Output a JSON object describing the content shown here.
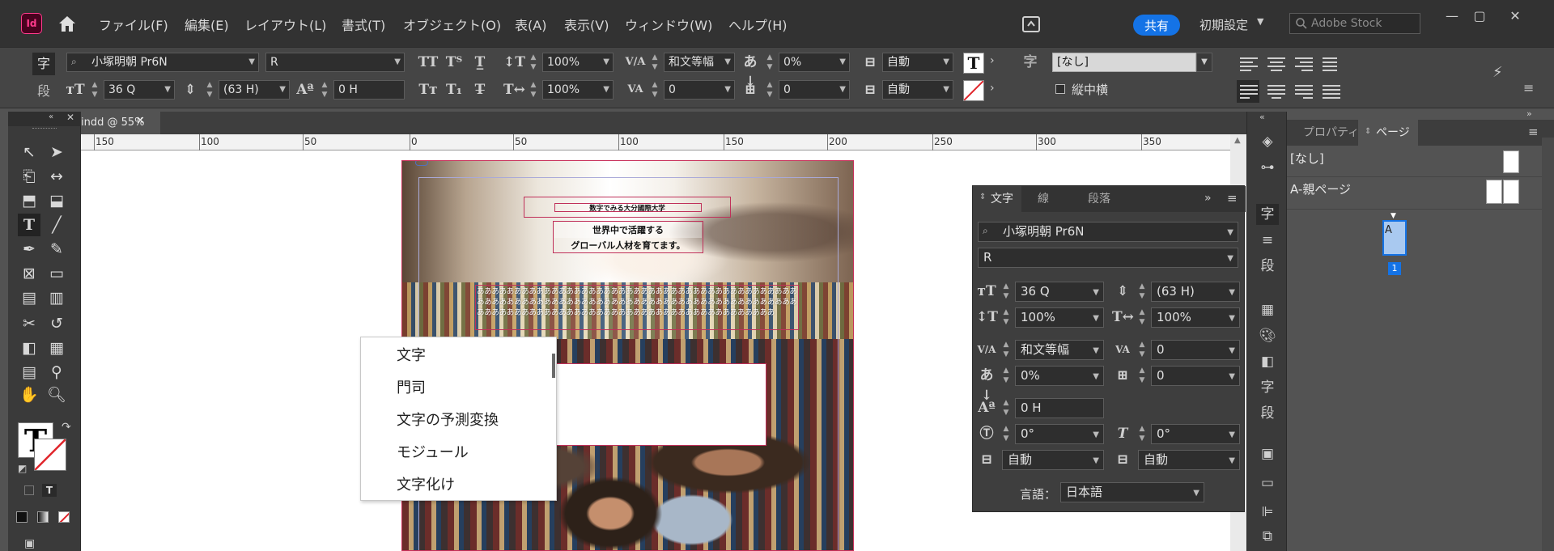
{
  "app": {
    "logo_text": "Id",
    "menu": [
      "ファイル(F)",
      "編集(E)",
      "レイアウト(L)",
      "書式(T)",
      "オブジェクト(O)",
      "表(A)",
      "表示(V)",
      "ウィンドウ(W)",
      "ヘルプ(H)"
    ],
    "share_label": "共有",
    "workspace_label": "初期設定",
    "search_placeholder": "Adobe Stock",
    "brand_color": "#ff3a8c",
    "accent_color": "#1473e6"
  },
  "control_bar": {
    "char_mode": "字",
    "para_mode": "段",
    "font_family": "小塚明朝 Pr6N",
    "font_style": "R",
    "font_size": "36 Q",
    "leading": "(63 H)",
    "tracking_baseline": "0 H",
    "vertical_scale": "100%",
    "horizontal_scale": "100%",
    "kerning": "和文等幅",
    "tracking": "0",
    "tsume": "0%",
    "mojikumi": "0",
    "aki_before": "自動",
    "aki_after": "自動",
    "char_style": "[なし]",
    "tatechuyoko_label": "縦中横"
  },
  "document": {
    "tab_label": "indd @ 55%",
    "ruler_ticks": [
      "150",
      "100",
      "50",
      "0",
      "50",
      "100",
      "150",
      "200",
      "250",
      "300",
      "350"
    ],
    "heading_small": "数字でみる大分國際大学",
    "heading_main_line1": "世界中で活躍する",
    "heading_main_line2": "グローバル人材を育てます。",
    "dummy_text": "ああああああああああああああああああああああああああああああああああああああああああああああああああああああああああああああああああああああああああああああああああああああああああああああああああああああああああああああああああああああああああああああ"
  },
  "context_menu": {
    "items": [
      "文字",
      "門司",
      "文字の予測変換",
      "モジュール",
      "文字化け"
    ]
  },
  "character_panel": {
    "tabs": [
      "文字",
      "線",
      "段落"
    ],
    "font_family": "小塚明朝 Pr6N",
    "font_style": "R",
    "font_size": "36 Q",
    "leading": "(63 H)",
    "vertical_scale": "100%",
    "horizontal_scale": "100%",
    "kerning": "和文等幅",
    "tracking": "0",
    "tsume": "0%",
    "mojikumi": "0",
    "baseline_shift": "0 H",
    "rotation": "0°",
    "skew": "0°",
    "aki_before": "自動",
    "aki_after": "自動",
    "language_label": "言語：",
    "language": "日本語"
  },
  "pages_panel": {
    "tabs": [
      "プロパティ",
      "ページ"
    ],
    "master_none": "[なし]",
    "master_a": "A-親ページ",
    "page_prefix": "A",
    "page_number": "1"
  }
}
